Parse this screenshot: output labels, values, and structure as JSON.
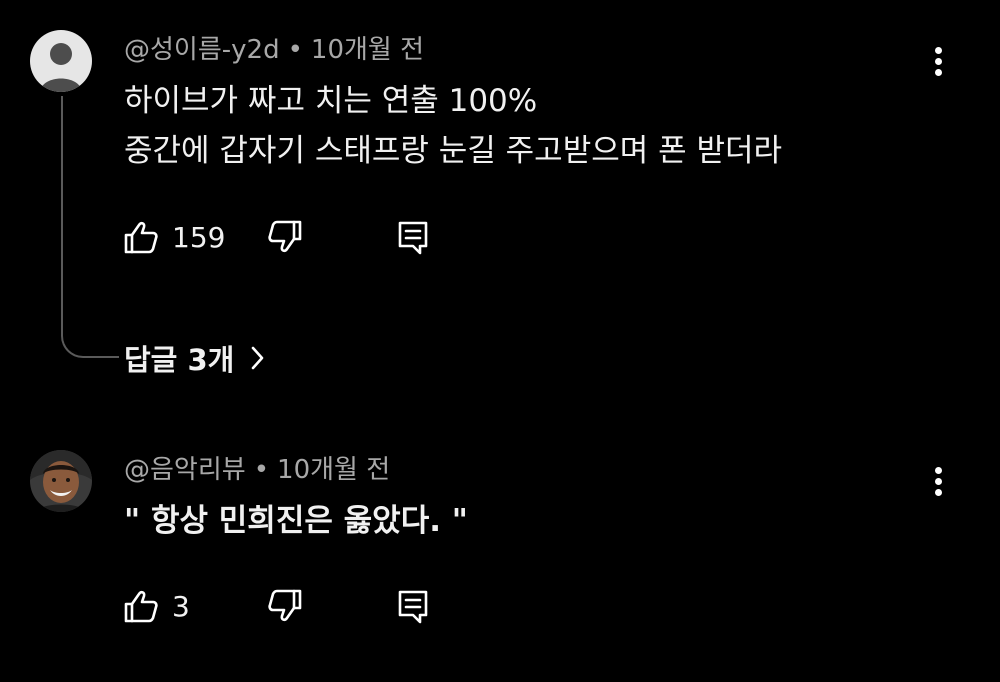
{
  "comments": [
    {
      "username": "@성이름-y2d",
      "separator": "•",
      "time": "10개월 전",
      "lines": [
        "하이브가 짜고 치는 연출 100%",
        "중간에 갑자기 스태프랑 눈길 주고받으며 폰 받더라"
      ],
      "likes": "159",
      "replies_label": "답글 3개"
    },
    {
      "username": "@음악리뷰",
      "separator": "•",
      "time": "10개월 전",
      "lines": [
        "\" 항상 민희진은 옳았다. \""
      ],
      "likes": "3"
    }
  ],
  "icons": {
    "like": "thumbs-up-icon",
    "dislike": "thumbs-down-icon",
    "reply": "reply-comment-icon",
    "menu": "more-vertical-icon",
    "chevron": "chevron-right-icon"
  },
  "colors": {
    "background": "#000000",
    "text": "#f1f1f1",
    "meta": "#a8a8a8",
    "thread_line": "#5a5a5a"
  }
}
